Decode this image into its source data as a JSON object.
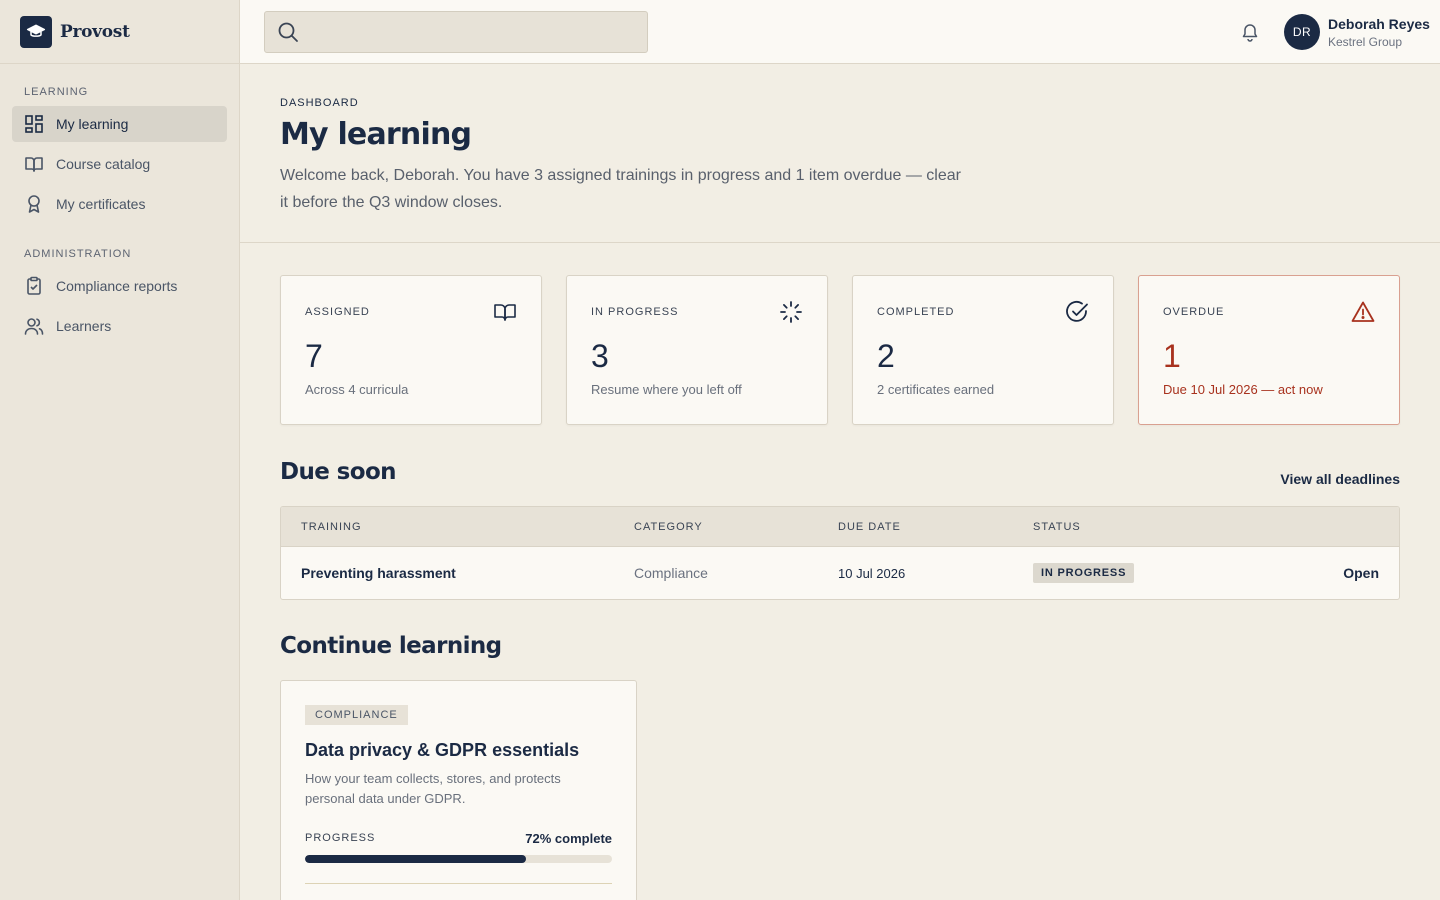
{
  "brand": {
    "name": "Provost"
  },
  "sidebar": {
    "sections": [
      {
        "heading": "LEARNING",
        "items": [
          {
            "label": "My learning",
            "active": true
          },
          {
            "label": "Course catalog",
            "active": false
          },
          {
            "label": "My certificates",
            "active": false
          }
        ]
      },
      {
        "heading": "ADMINISTRATION",
        "items": [
          {
            "label": "Compliance reports",
            "active": false
          },
          {
            "label": "Learners",
            "active": false
          }
        ]
      }
    ]
  },
  "topbar": {
    "search": {
      "value": "",
      "placeholder": ""
    },
    "user": {
      "initials": "DR",
      "name": "Deborah Reyes",
      "org": "Kestrel Group"
    }
  },
  "page": {
    "eyebrow": "DASHBOARD",
    "title": "My learning",
    "welcome": "Welcome back, Deborah. You have 3 assigned trainings in progress and 1 item overdue — clear it before the Q3 window closes."
  },
  "stats": [
    {
      "label": "ASSIGNED",
      "value": "7",
      "sub": "Across 4 curricula",
      "icon": "book-icon"
    },
    {
      "label": "IN PROGRESS",
      "value": "3",
      "sub": "Resume where you left off",
      "icon": "loader-icon"
    },
    {
      "label": "COMPLETED",
      "value": "2",
      "sub": "2 certificates earned",
      "icon": "check-circle-icon"
    },
    {
      "label": "OVERDUE",
      "value": "1",
      "sub": "Due 10 Jul 2026 — act now",
      "icon": "warning-icon"
    }
  ],
  "due_soon": {
    "title": "Due soon",
    "view_all": "View all deadlines",
    "columns": [
      "TRAINING",
      "CATEGORY",
      "DUE DATE",
      "STATUS"
    ],
    "rows": [
      {
        "training": "Preventing harassment",
        "category": "Compliance",
        "due": "10 Jul 2026",
        "status": "IN PROGRESS",
        "action": "Open"
      }
    ]
  },
  "continue": {
    "title": "Continue learning",
    "course": {
      "tag": "COMPLIANCE",
      "title": "Data privacy & GDPR essentials",
      "description": "How your team collects, stores, and protects personal data under GDPR.",
      "progress_label": "PROGRESS",
      "progress_text": "72% complete",
      "progress": 0.72
    }
  },
  "colors": {
    "navy": "#1b2a44",
    "danger": "#a8321e",
    "background": "#f2eee4"
  }
}
